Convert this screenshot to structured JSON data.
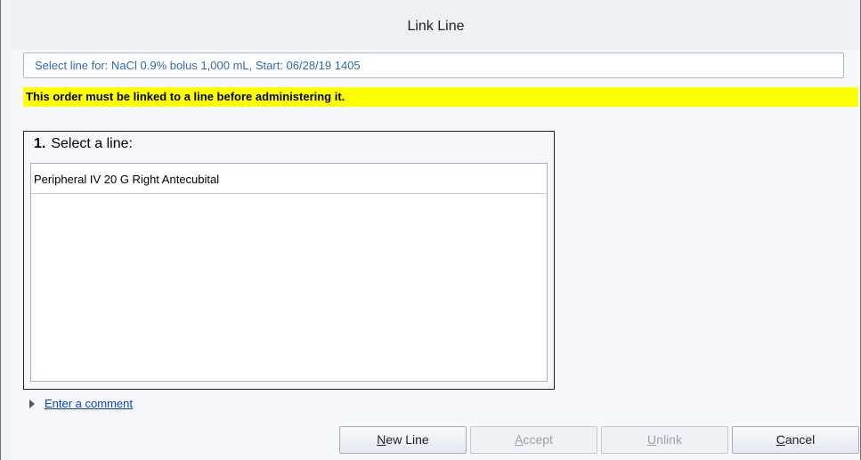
{
  "window": {
    "title": "Link Line"
  },
  "header": {
    "text": "Select line for: NaCl 0.9% bolus 1,000 mL, Start: 06/28/19 1405"
  },
  "warning": {
    "text": "This order must be linked to a line before administering it.",
    "background": "#ffff00"
  },
  "select_line": {
    "step_number": "1.",
    "label": "Select a line:",
    "items": [
      {
        "label": "Peripheral IV 20 G Right Antecubital"
      }
    ]
  },
  "comment": {
    "expander_icon": "triangle-right-icon",
    "link_text": "Enter a comment"
  },
  "buttons": {
    "new_line": {
      "mnemonic": "N",
      "rest": "ew Line",
      "enabled": true
    },
    "accept": {
      "mnemonic": "A",
      "rest": "ccept",
      "enabled": false
    },
    "unlink": {
      "mnemonic": "U",
      "rest": "nlink",
      "enabled": false
    },
    "cancel": {
      "mnemonic": "C",
      "rest": "ancel",
      "enabled": true
    }
  }
}
